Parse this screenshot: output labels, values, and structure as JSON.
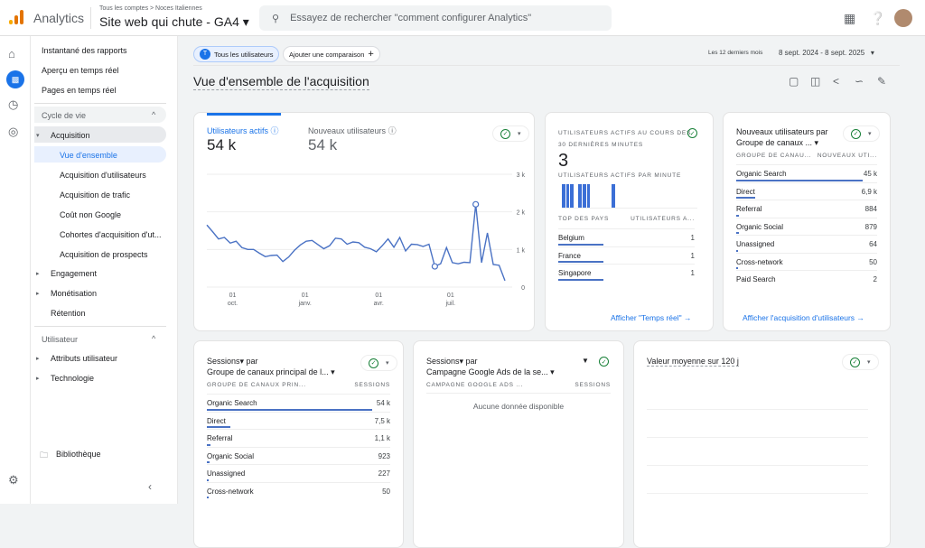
{
  "header": {
    "app": "Analytics",
    "breadcrumb": "Tous les comptes > Noces Italiennes",
    "property": "Site web qui chute - GA4 ▾",
    "search_placeholder": "Essayez de rechercher \"comment configurer Analytics\""
  },
  "nav": {
    "top": [
      "Instantané des rapports",
      "Aperçu en temps réel",
      "Pages en temps réel"
    ],
    "lifecycle": "Cycle de vie",
    "acquisition": "Acquisition",
    "acq_items": [
      "Vue d'ensemble",
      "Acquisition d'utilisateurs",
      "Acquisition de trafic",
      "Coût non Google",
      "Cohortes d'acquisition d'ut...",
      "Acquisition de prospects"
    ],
    "engagement": "Engagement",
    "monetisation": "Monétisation",
    "retention": "Rétention",
    "user": "Utilisateur",
    "user_items": [
      "Attributs utilisateur",
      "Technologie"
    ],
    "library": "Bibliothèque"
  },
  "toolbar": {
    "segment_initial": "T",
    "segment": "Tous les utilisateurs",
    "add_comparison": "Ajouter une comparaison",
    "date_label": "Les 12 derniers mois",
    "date_range": "8 sept. 2024 - 8 sept. 2025",
    "page_title": "Vue d'ensemble de l'acquisition"
  },
  "overview": {
    "metric1": "Utilisateurs actifs",
    "value1": "54 k",
    "metric2": "Nouveaux utilisateurs",
    "value2": "54 k"
  },
  "chart_data": {
    "type": "line",
    "series": [
      {
        "name": "Utilisateurs actifs",
        "values": [
          1.65,
          1.47,
          1.28,
          1.32,
          1.17,
          1.22,
          1.05,
          1.0,
          1.0,
          0.9,
          0.81,
          0.84,
          0.85,
          0.68,
          0.8,
          0.98,
          1.12,
          1.22,
          1.24,
          1.13,
          1.02,
          1.1,
          1.3,
          1.28,
          1.14,
          1.2,
          1.18,
          1.06,
          1.02,
          0.94,
          1.1,
          1.28,
          1.06,
          1.32,
          0.96,
          1.14,
          1.13,
          1.08,
          1.14,
          0.55,
          0.62,
          1.05,
          0.65,
          0.62,
          0.66,
          0.65,
          2.2,
          0.65,
          1.44,
          0.6,
          0.58,
          0.17
        ]
      }
    ],
    "yticks": [
      "0",
      "1 k",
      "2 k",
      "3 k"
    ],
    "ylim": [
      0,
      3
    ],
    "xticks": [
      {
        "i": 4.4,
        "day": "01",
        "month": "oct."
      },
      {
        "i": 16.8,
        "day": "01",
        "month": "janv."
      },
      {
        "i": 29.4,
        "day": "01",
        "month": "avr."
      },
      {
        "i": 41.7,
        "day": "01",
        "month": "juil."
      }
    ]
  },
  "realtime": {
    "title1": "UTILISATEURS ACTIFS AU COURS DES",
    "title2": "30 DERNIÈRES MINUTES",
    "value": "3",
    "per_minute": "UTILISATEURS ACTIFS PAR MINUTE",
    "bars": [
      1,
      1,
      1,
      0,
      1,
      1,
      1,
      0,
      0,
      0,
      0,
      0,
      1
    ],
    "col1": "TOP DES PAYS",
    "col2": "UTILISATEURS A...",
    "rows": [
      {
        "name": "Belgium",
        "value": "1",
        "pct": 1
      },
      {
        "name": "France",
        "value": "1",
        "pct": 1
      },
      {
        "name": "Singapore",
        "value": "1",
        "pct": 1
      }
    ],
    "link": "Afficher \"Temps réel\""
  },
  "newusers": {
    "title1": "Nouveaux utilisateurs par",
    "title2": "Groupe de canaux ... ▾",
    "col1": "GROUPE DE CANAU...",
    "col2": "NOUVEAUX UTI...",
    "rows": [
      {
        "name": "Organic Search",
        "value": "45 k",
        "pct": 1
      },
      {
        "name": "Direct",
        "value": "6,9 k",
        "pct": 0.15
      },
      {
        "name": "Referral",
        "value": "884",
        "pct": 0.02
      },
      {
        "name": "Organic Social",
        "value": "879",
        "pct": 0.02
      },
      {
        "name": "Unassigned",
        "value": "64",
        "pct": 0.005
      },
      {
        "name": "Cross-network",
        "value": "50",
        "pct": 0.004
      },
      {
        "name": "Paid Search",
        "value": "2",
        "pct": 0
      }
    ],
    "link": "Afficher l'acquisition d'utilisateurs"
  },
  "sessions": {
    "title1": "Sessions▾ par",
    "title2": "Groupe de canaux principal de l... ▾",
    "col1": "GROUPE DE CANAUX PRIN...",
    "col2": "SESSIONS",
    "rows": [
      {
        "name": "Organic Search",
        "value": "54 k",
        "pct": 1
      },
      {
        "name": "Direct",
        "value": "7,5 k",
        "pct": 0.14
      },
      {
        "name": "Referral",
        "value": "1,1 k",
        "pct": 0.02
      },
      {
        "name": "Organic Social",
        "value": "923",
        "pct": 0.017
      },
      {
        "name": "Unassigned",
        "value": "227",
        "pct": 0.004
      },
      {
        "name": "Cross-network",
        "value": "50",
        "pct": 0.001
      }
    ]
  },
  "campaign": {
    "title1": "Sessions▾ par",
    "title2": "Campagne Google Ads de la se... ▾",
    "col1": "CAMPAGNE GOOGLE ADS ...",
    "col2": "SESSIONS",
    "empty": "Aucune donnée disponible"
  },
  "ltv": {
    "title": "Valeur moyenne sur 120 j"
  }
}
